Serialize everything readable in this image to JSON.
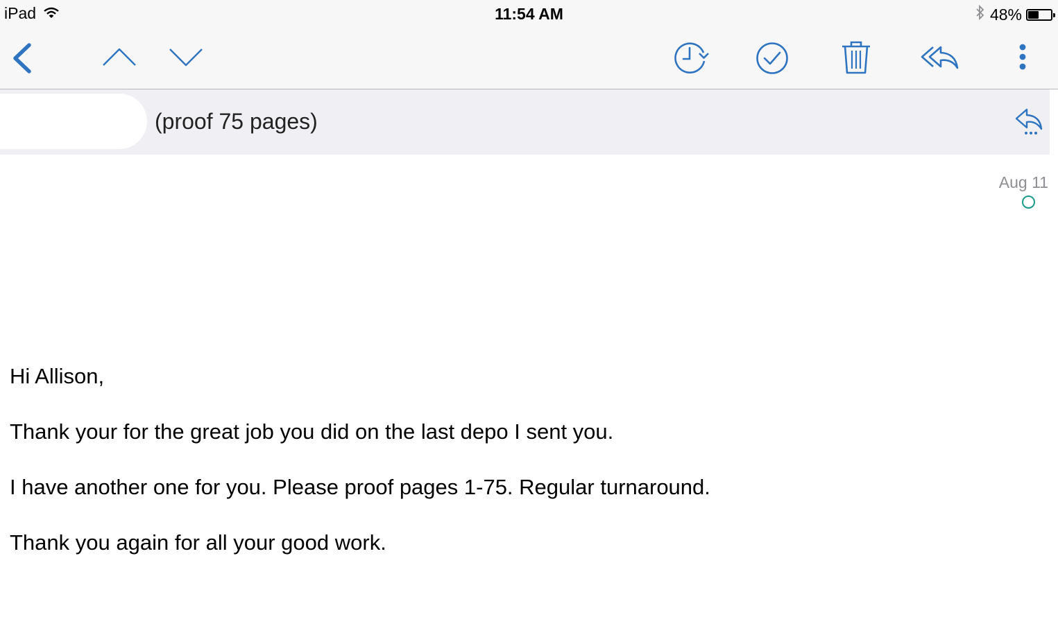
{
  "status_bar": {
    "device": "iPad",
    "time": "11:54 AM",
    "battery_text": "48%",
    "battery_level": 0.48,
    "icons": [
      "wifi-icon",
      "bluetooth-icon",
      "battery-icon"
    ]
  },
  "toolbar": {
    "accent_color": "#2f74c0",
    "icons": [
      "back-chevron-icon",
      "previous-message-icon",
      "next-message-icon",
      "snooze-clock-icon",
      "mark-done-icon",
      "trash-icon",
      "reply-all-icon",
      "more-options-icon"
    ]
  },
  "message": {
    "subject": "(proof 75 pages)",
    "date": "Aug 11",
    "body": [
      "Hi Allison,",
      "Thank your for the great job you did on the last depo I sent you.",
      "I have another one for you. Please proof pages 1-75. Regular turnaround.",
      "Thank you again for all your good work."
    ]
  }
}
